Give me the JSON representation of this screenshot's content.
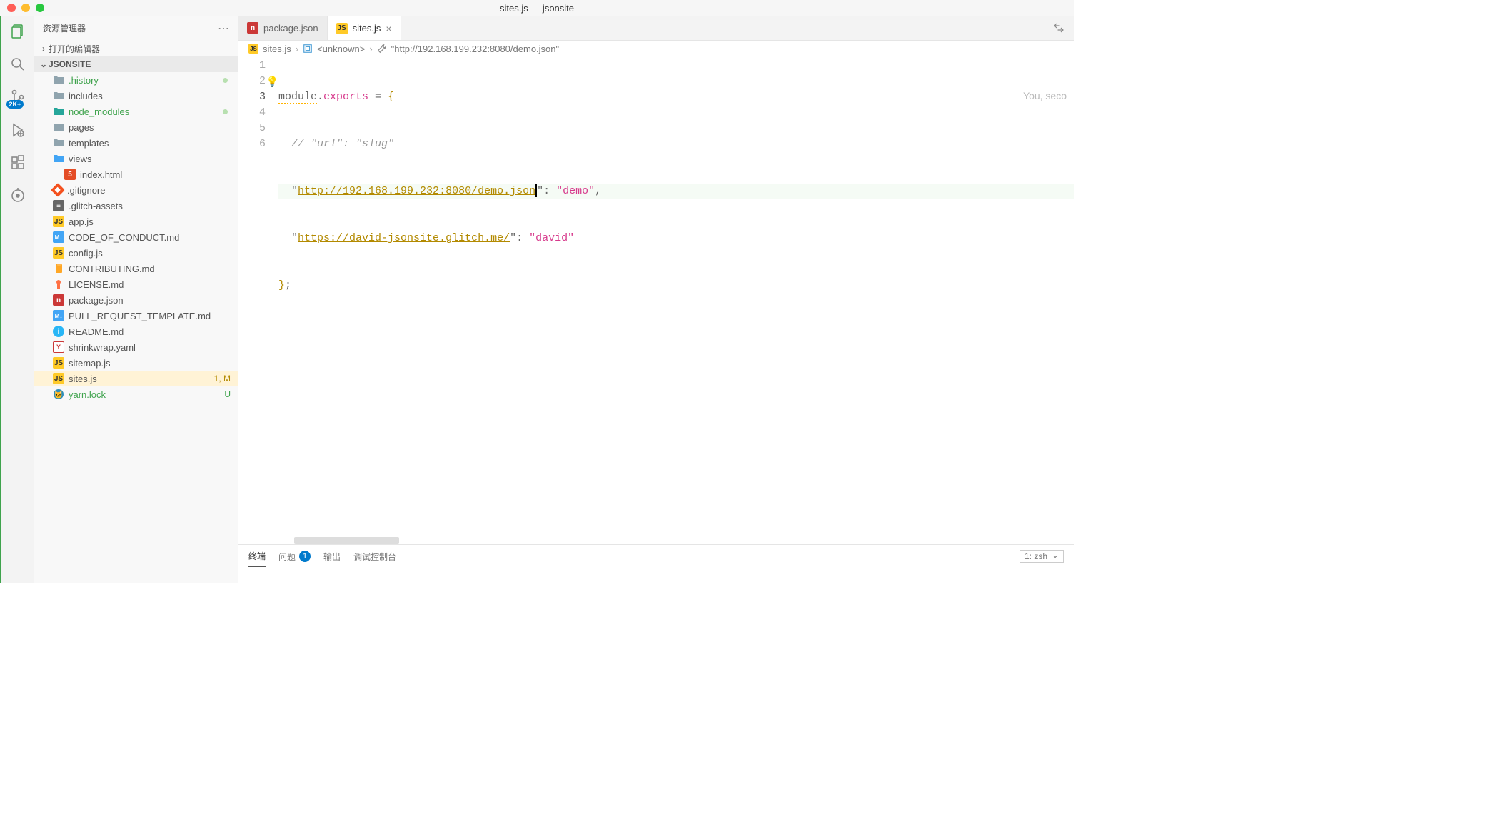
{
  "window": {
    "title": "sites.js — jsonsite"
  },
  "traffic_lights": [
    "close",
    "minimize",
    "maximize"
  ],
  "activity_bar": {
    "items": [
      {
        "name": "explorer-icon",
        "active": true
      },
      {
        "name": "search-icon",
        "active": false
      },
      {
        "name": "source-control-icon",
        "active": false,
        "badge": "2K+"
      },
      {
        "name": "run-debug-icon",
        "active": false
      },
      {
        "name": "extensions-icon",
        "active": false
      },
      {
        "name": "gitlens-icon",
        "active": false
      }
    ]
  },
  "sidebar": {
    "title": "资源管理器",
    "more_tooltip": "More actions",
    "sections": {
      "open_editors": {
        "label": "打开的编辑器",
        "expanded": false
      },
      "folder": {
        "label": "JSONSITE",
        "expanded": true
      }
    },
    "tree": [
      {
        "name": ".history",
        "type": "folder",
        "class": "green",
        "dot": true
      },
      {
        "name": "includes",
        "type": "folder"
      },
      {
        "name": "node_modules",
        "type": "folder",
        "class": "green teal",
        "dot": true
      },
      {
        "name": "pages",
        "type": "folder"
      },
      {
        "name": "templates",
        "type": "folder"
      },
      {
        "name": "views",
        "type": "folder",
        "expanded": true,
        "class": "blue"
      },
      {
        "name": "index.html",
        "type": "html",
        "indent": 2
      },
      {
        "name": ".gitignore",
        "type": "git"
      },
      {
        "name": ".glitch-assets",
        "type": "glitch"
      },
      {
        "name": "app.js",
        "type": "js"
      },
      {
        "name": "CODE_OF_CONDUCT.md",
        "type": "md"
      },
      {
        "name": "config.js",
        "type": "js"
      },
      {
        "name": "CONTRIBUTING.md",
        "type": "clip"
      },
      {
        "name": "LICENSE.md",
        "type": "lic"
      },
      {
        "name": "package.json",
        "type": "npm"
      },
      {
        "name": "PULL_REQUEST_TEMPLATE.md",
        "type": "md"
      },
      {
        "name": "README.md",
        "type": "info"
      },
      {
        "name": "shrinkwrap.yaml",
        "type": "yml"
      },
      {
        "name": "sitemap.js",
        "type": "js"
      },
      {
        "name": "sites.js",
        "type": "js",
        "selected": true,
        "status": "1, M"
      },
      {
        "name": "yarn.lock",
        "type": "yarn",
        "class": "green",
        "status": "U",
        "status_class": "u"
      }
    ]
  },
  "tabs": [
    {
      "label": "package.json",
      "icon": "npm",
      "active": false
    },
    {
      "label": "sites.js",
      "icon": "js",
      "active": true,
      "close": true
    }
  ],
  "breadcrumb": {
    "parts": [
      {
        "icon": "js",
        "label": "sites.js"
      },
      {
        "icon": "module",
        "label": "<unknown>"
      },
      {
        "icon": "wrench",
        "label": "\"http://192.168.199.232:8080/demo.json\""
      }
    ]
  },
  "editor": {
    "lines": [
      "1",
      "2",
      "3",
      "4",
      "5",
      "6"
    ],
    "active_line": 3,
    "lightbulb_line": 2,
    "codelens_hint": "You, seco",
    "code": {
      "l1_module": "module",
      "l1_dot": ".",
      "l1_exports": "exports",
      "l1_eq": " = ",
      "l1_brace": "{",
      "l2_comment": "// \"url\": \"slug\"",
      "l3_q1": "\"",
      "l3_url": "http://192.168.199.232:8080/demo.json",
      "l3_q2": "\"",
      "l3_colon": ": ",
      "l3_val": "\"demo\"",
      "l3_comma": ",",
      "l4_q1": "\"",
      "l4_url": "https://david-jsonsite.glitch.me/",
      "l4_q2": "\"",
      "l4_colon": ": ",
      "l4_val": "\"david\"",
      "l5_brace": "}",
      "l5_semi": ";"
    }
  },
  "panel": {
    "tabs": [
      {
        "label": "终端",
        "active": true
      },
      {
        "label": "问题",
        "badge": "1"
      },
      {
        "label": "输出"
      },
      {
        "label": "调试控制台"
      }
    ],
    "terminal_select": "1: zsh"
  }
}
